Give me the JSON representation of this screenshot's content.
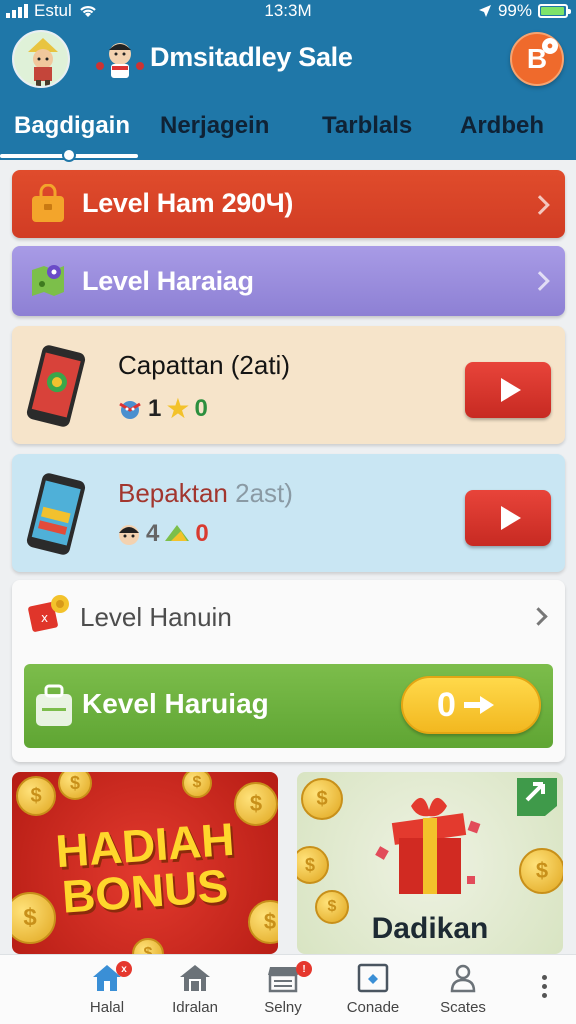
{
  "status_bar": {
    "carrier": "Estul",
    "time": "13:3M",
    "battery": "99%"
  },
  "header": {
    "app_title": "Dmsitadley Sale",
    "profile_badge": "B"
  },
  "tabs": [
    {
      "label": "Bagdigain",
      "active": true
    },
    {
      "label": "Nerjagein",
      "active": false
    },
    {
      "label": "Tarblals",
      "active": false
    },
    {
      "label": "Ardbeh",
      "active": false
    }
  ],
  "banners": [
    {
      "label": "Level Ham 290Ч)",
      "color": "#d94328"
    },
    {
      "label": "Level Haraiag",
      "color": "#9a8de0"
    }
  ],
  "cards": [
    {
      "title": "Capattan (2ati)",
      "stat1": "1",
      "stat2": "0"
    },
    {
      "title_highlight": "Bepaktan",
      "title_rest": "2ast)",
      "stat1": "4",
      "stat2": "0"
    }
  ],
  "panel": {
    "row_label": "Level Hanuin",
    "green_label": "Kevel Haruiag",
    "coin_value": "0"
  },
  "promos": {
    "left_line1": "HADIAH",
    "left_line2": "BONUS",
    "right_title": "Dadikan"
  },
  "bottom_nav": [
    {
      "label": "Halal",
      "icon": "home-icon",
      "badge": "x"
    },
    {
      "label": "Idralan",
      "icon": "house-icon"
    },
    {
      "label": "Selny",
      "icon": "store-icon",
      "badge": "!"
    },
    {
      "label": "Conade",
      "icon": "card-icon"
    },
    {
      "label": "Scates",
      "icon": "person-icon"
    }
  ]
}
